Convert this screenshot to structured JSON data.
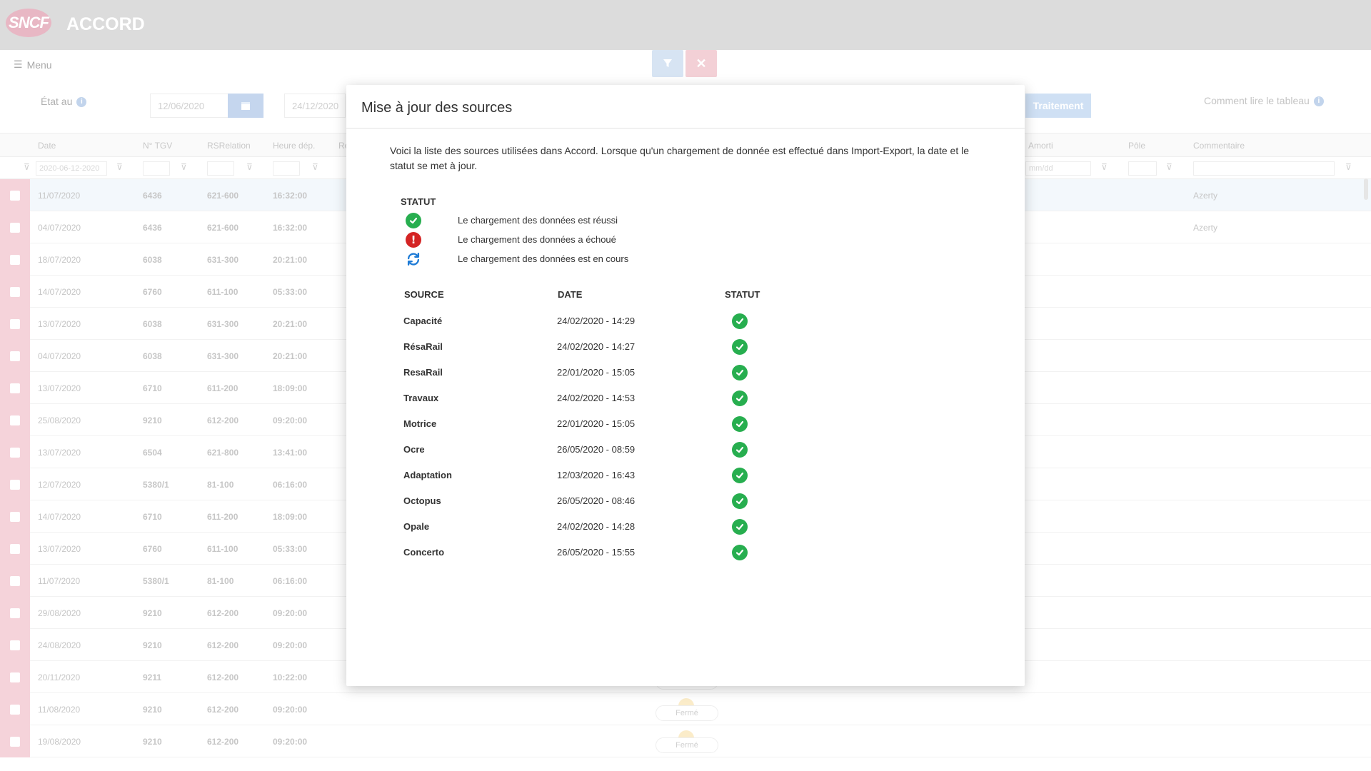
{
  "header": {
    "logo": "SNCF",
    "title": "ACCORD"
  },
  "toolbar": {
    "menu_label": "Menu",
    "etat_label": "État au",
    "date_from": "12/06/2020",
    "date_to": "24/12/2020",
    "traitement_label": "Traitement",
    "comment_lire": "Comment lire le tableau"
  },
  "grid": {
    "columns": [
      "Date",
      "N° TGV",
      "RSRelation",
      "Heure dép.",
      "Re",
      "Amorti",
      "Pôle",
      "Commentaire"
    ],
    "filter_date": "2020-06-12-2020",
    "filter_amorti": "mm/dd",
    "rows": [
      {
        "date": "11/07/2020",
        "tgv": "6436",
        "rel": "621-600",
        "heure": "16:32:00",
        "comment": "Azerty"
      },
      {
        "date": "04/07/2020",
        "tgv": "6436",
        "rel": "621-600",
        "heure": "16:32:00",
        "comment": "Azerty"
      },
      {
        "date": "18/07/2020",
        "tgv": "6038",
        "rel": "631-300",
        "heure": "20:21:00",
        "comment": ""
      },
      {
        "date": "14/07/2020",
        "tgv": "6760",
        "rel": "611-100",
        "heure": "05:33:00",
        "comment": ""
      },
      {
        "date": "13/07/2020",
        "tgv": "6038",
        "rel": "631-300",
        "heure": "20:21:00",
        "comment": ""
      },
      {
        "date": "04/07/2020",
        "tgv": "6038",
        "rel": "631-300",
        "heure": "20:21:00",
        "comment": ""
      },
      {
        "date": "13/07/2020",
        "tgv": "6710",
        "rel": "611-200",
        "heure": "18:09:00",
        "comment": ""
      },
      {
        "date": "25/08/2020",
        "tgv": "9210",
        "rel": "612-200",
        "heure": "09:20:00",
        "comment": ""
      },
      {
        "date": "13/07/2020",
        "tgv": "6504",
        "rel": "621-800",
        "heure": "13:41:00",
        "comment": ""
      },
      {
        "date": "12/07/2020",
        "tgv": "5380/1",
        "rel": "81-100",
        "heure": "06:16:00",
        "comment": ""
      },
      {
        "date": "14/07/2020",
        "tgv": "6710",
        "rel": "611-200",
        "heure": "18:09:00",
        "comment": ""
      },
      {
        "date": "13/07/2020",
        "tgv": "6760",
        "rel": "611-100",
        "heure": "05:33:00",
        "comment": ""
      },
      {
        "date": "11/07/2020",
        "tgv": "5380/1",
        "rel": "81-100",
        "heure": "06:16:00",
        "comment": ""
      },
      {
        "date": "29/08/2020",
        "tgv": "9210",
        "rel": "612-200",
        "heure": "09:20:00",
        "comment": ""
      },
      {
        "date": "24/08/2020",
        "tgv": "9210",
        "rel": "612-200",
        "heure": "09:20:00",
        "comment": ""
      },
      {
        "date": "20/11/2020",
        "tgv": "9211",
        "rel": "612-200",
        "heure": "10:22:00",
        "comment": ""
      },
      {
        "date": "11/08/2020",
        "tgv": "9210",
        "rel": "612-200",
        "heure": "09:20:00",
        "comment": ""
      },
      {
        "date": "19/08/2020",
        "tgv": "9210",
        "rel": "612-200",
        "heure": "09:20:00",
        "comment": ""
      }
    ],
    "ferme_label": "Fermé"
  },
  "modal": {
    "title": "Mise à jour des sources",
    "intro": "Voici la liste des sources utilisées dans Accord. Lorsque qu'un chargement de donnée est effectué dans Import-Export, la date et le statut se met à jour.",
    "legend_title": "STATUT",
    "legend": [
      {
        "icon": "check-circle-icon",
        "label": "Le chargement des données est réussi"
      },
      {
        "icon": "error-circle-icon",
        "label": "Le chargement des données a échoué"
      },
      {
        "icon": "sync-icon",
        "label": "Le chargement des données est en cours"
      }
    ],
    "table_headers": {
      "source": "SOURCE",
      "date": "DATE",
      "statut": "STATUT"
    },
    "sources": [
      {
        "name": "Capacité",
        "date": "24/02/2020 - 14:29",
        "status": "success"
      },
      {
        "name": "RésaRail",
        "date": "24/02/2020 - 14:27",
        "status": "success"
      },
      {
        "name": "ResaRail",
        "date": "22/01/2020 - 15:05",
        "status": "success"
      },
      {
        "name": "Travaux",
        "date": "24/02/2020 - 14:53",
        "status": "success"
      },
      {
        "name": "Motrice",
        "date": "22/01/2020 - 15:05",
        "status": "success"
      },
      {
        "name": "Ocre",
        "date": "26/05/2020 - 08:59",
        "status": "success"
      },
      {
        "name": "Adaptation",
        "date": "12/03/2020 - 16:43",
        "status": "success"
      },
      {
        "name": "Octopus",
        "date": "26/05/2020 - 08:46",
        "status": "success"
      },
      {
        "name": "Opale",
        "date": "24/02/2020 - 14:28",
        "status": "success"
      },
      {
        "name": "Concerto",
        "date": "26/05/2020 - 15:55",
        "status": "success"
      }
    ]
  },
  "colors": {
    "success": "#27ae4f",
    "error": "#d42424",
    "sync": "#1e7bd6",
    "header_bg": "#dcdcdc"
  }
}
